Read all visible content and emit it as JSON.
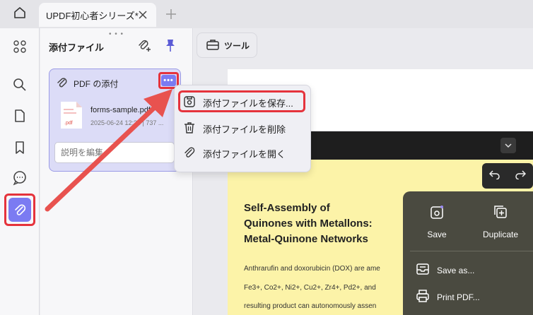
{
  "tabbar": {
    "doc_tab_title": "UPDF初心者シリーズ*",
    "home_icon": "home-icon",
    "close_icon": "close-icon",
    "new_tab_icon": "plus-icon"
  },
  "rail": {
    "items": [
      "grid-icon",
      "search-icon",
      "page-icon",
      "bookmark-icon",
      "comment-icon",
      "paperclip-icon"
    ],
    "active_item": "paperclip-icon"
  },
  "panel": {
    "title": "添付ファイル",
    "attachment": {
      "header": "PDF の添付",
      "file_name": "forms-sample.pdf",
      "file_meta": "2025-06-24 12:38 | 737 ...",
      "file_ext": ".pdf",
      "description_placeholder": "説明を編集"
    }
  },
  "context_menu": {
    "items": [
      "添付ファイルを保存...",
      "添付ファイルを削除",
      "添付ファイルを開く"
    ]
  },
  "toolbar": {
    "tool_label": "ツール"
  },
  "document": {
    "title_lines": [
      "Self-Assembly of",
      "Quinones with Metallons:",
      "Metal-Quinone Networks"
    ],
    "body_lines": [
      "Anthrarufin and doxorubicin (DOX) are ame",
      "Fe3+, Co2+, Ni2+, Cu2+, Zr4+, Pd2+, and",
      "resulting product can autonomously assen"
    ]
  },
  "floating_menu": {
    "save_label": "Save",
    "duplicate_label": "Duplicate",
    "save_as_label": "Save as...",
    "print_label": "Print PDF..."
  },
  "colors": {
    "accent": "#7b7bf2",
    "highlight_red": "#e5333c",
    "paper_yellow": "#fcf3a8"
  }
}
